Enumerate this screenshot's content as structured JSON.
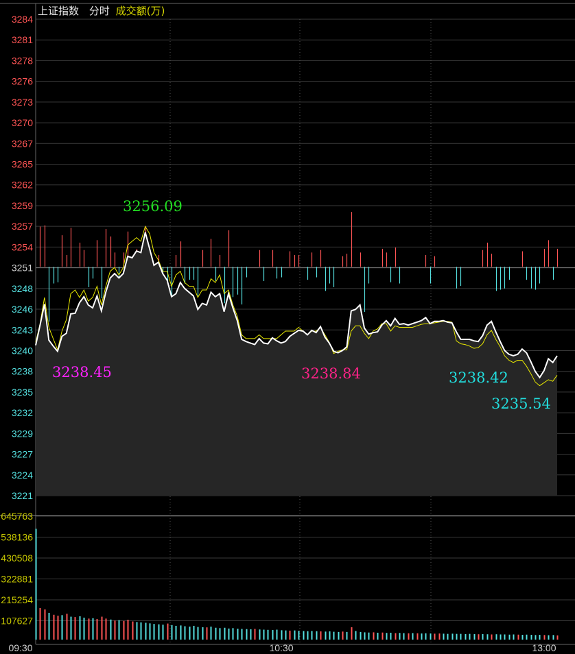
{
  "header": {
    "index_name": "上证指数",
    "mode": "分时",
    "indicator": "成交额(万)"
  },
  "colors": {
    "up": "#ff5555",
    "down": "#55e0e0",
    "price_line": "#ffffff",
    "avg_line": "#e8e800",
    "grid": "#3a3a3a",
    "annotation_high": "#22dd22",
    "annotation_low_1": "#ff22ff",
    "annotation_low_2": "#ff2288",
    "annotation_low_3": "#22dddd",
    "volume_axis": "#c8c800"
  },
  "chart_data": [
    {
      "type": "line",
      "name": "intraday-price",
      "y_axis_ticks": [
        "3284",
        "3281",
        "3278",
        "3276",
        "3273",
        "3270",
        "3267",
        "3265",
        "3262",
        "3259",
        "3257",
        "3254",
        "3251",
        "3248",
        "3246",
        "3243",
        "3240",
        "3238",
        "3235",
        "3232",
        "3229",
        "3227",
        "3224",
        "3221"
      ],
      "ylim": [
        3220.5,
        3284.2
      ],
      "baseline": 3251.1,
      "x_ticks": [
        "09:30",
        "10:30",
        "13:00"
      ],
      "x_count": 120,
      "series": [
        {
          "role": "price",
          "values": [
            3240.6,
            3243.3,
            3246.1,
            3241.3,
            3240.5,
            3239.8,
            3241.8,
            3242.2,
            3244.8,
            3244.9,
            3246.3,
            3247.1,
            3246.0,
            3245.6,
            3247.2,
            3245.2,
            3247.7,
            3249.6,
            3250.2,
            3249.6,
            3250.2,
            3252.5,
            3252.3,
            3253.2,
            3253.0,
            3255.7,
            3253.5,
            3251.3,
            3251.7,
            3250.2,
            3249.3,
            3247.1,
            3247.5,
            3249.0,
            3248.2,
            3247.7,
            3247.2,
            3245.4,
            3246.2,
            3246.0,
            3247.7,
            3247.1,
            3247.5,
            3245.1,
            3247.5,
            3245.6,
            3243.9,
            3241.4,
            3241.1,
            3240.9,
            3240.7,
            3241.5,
            3240.9,
            3240.8,
            3241.6,
            3241.2,
            3240.9,
            3241.1,
            3241.8,
            3242.2,
            3242.6,
            3242.5,
            3242.0,
            3242.6,
            3242.3,
            3243.1,
            3241.7,
            3240.9,
            3239.8,
            3239.6,
            3239.9,
            3240.4,
            3245.2,
            3245.4,
            3246.0,
            3242.9,
            3242.1,
            3242.3,
            3242.4,
            3243.3,
            3243.9,
            3243.2,
            3244.2,
            3243.4,
            3243.5,
            3243.3,
            3243.5,
            3243.7,
            3243.9,
            3244.3,
            3243.5,
            3243.8,
            3243.8,
            3243.9,
            3243.7,
            3243.6,
            3242.4,
            3241.4,
            3241.4,
            3241.4,
            3241.2,
            3241.1,
            3241.9,
            3243.3,
            3243.8,
            3242.4,
            3241.1,
            3239.9,
            3239.4,
            3239.2,
            3239.4,
            3240.1,
            3239.6,
            3238.4,
            3237.1,
            3236.3,
            3237.2,
            3238.8,
            3238.3,
            3239.2
          ]
        },
        {
          "role": "average",
          "values": [
            3241.0,
            3243.5,
            3247.0,
            3243.0,
            3241.5,
            3240.0,
            3242.5,
            3244.0,
            3247.5,
            3248.0,
            3247.0,
            3248.0,
            3246.5,
            3247.0,
            3248.5,
            3246.0,
            3248.5,
            3250.5,
            3251.0,
            3250.0,
            3251.0,
            3254.0,
            3254.5,
            3255.0,
            3254.5,
            3256.5,
            3255.5,
            3253.0,
            3252.0,
            3250.5,
            3250.5,
            3248.5,
            3250.0,
            3250.5,
            3249.0,
            3248.5,
            3248.5,
            3247.0,
            3248.0,
            3248.0,
            3249.5,
            3249.0,
            3250.0,
            3247.5,
            3248.0,
            3246.0,
            3244.5,
            3242.0,
            3241.5,
            3241.5,
            3241.5,
            3242.0,
            3241.5,
            3241.5,
            3241.5,
            3241.5,
            3242.0,
            3242.5,
            3242.5,
            3242.5,
            3243.0,
            3242.5,
            3242.0,
            3242.5,
            3242.5,
            3243.0,
            3242.0,
            3241.0,
            3239.5,
            3239.8,
            3240.0,
            3240.0,
            3242.5,
            3243.2,
            3243.2,
            3242.2,
            3241.5,
            3242.5,
            3242.8,
            3243.5,
            3243.5,
            3242.5,
            3243.2,
            3243.0,
            3243.0,
            3243.0,
            3243.0,
            3243.2,
            3243.4,
            3243.5,
            3243.5,
            3243.6,
            3243.7,
            3243.8,
            3243.8,
            3243.7,
            3241.2,
            3240.8,
            3240.7,
            3240.5,
            3240.2,
            3240.3,
            3240.8,
            3242.0,
            3242.6,
            3241.4,
            3240.4,
            3239.2,
            3238.6,
            3238.3,
            3238.6,
            3238.6,
            3237.8,
            3236.8,
            3235.7,
            3235.2,
            3235.6,
            3236.0,
            3235.8,
            3236.6
          ]
        }
      ],
      "annotations": [
        {
          "text": "3256.09",
          "role": "high"
        },
        {
          "text": "3238.45",
          "role": "low_1"
        },
        {
          "text": "3238.84",
          "role": "low_2"
        },
        {
          "text": "3238.42",
          "role": "low_3"
        },
        {
          "text": "3235.54",
          "role": "low_4"
        }
      ],
      "grid": true
    },
    {
      "type": "bar",
      "name": "turnover",
      "y_axis_ticks": [
        "645763",
        "538136",
        "430508",
        "322881",
        "215254",
        "107627"
      ],
      "ylim": [
        0,
        645763
      ],
      "x_count": 120,
      "values": [
        580000,
        165000,
        158000,
        140000,
        130000,
        125000,
        128000,
        135000,
        120000,
        118000,
        122000,
        115000,
        110000,
        112000,
        108000,
        120000,
        110000,
        105000,
        100000,
        102000,
        98000,
        104000,
        95000,
        92000,
        90000,
        88000,
        85000,
        82000,
        80000,
        78000,
        84000,
        76000,
        72000,
        74000,
        70000,
        68000,
        72000,
        66000,
        65000,
        64000,
        68000,
        62000,
        60000,
        62000,
        58000,
        60000,
        57000,
        56000,
        55000,
        54000,
        56000,
        53000,
        52000,
        51000,
        50000,
        52000,
        49000,
        48000,
        47000,
        48000,
        46000,
        45000,
        44000,
        45000,
        44000,
        43000,
        42000,
        43000,
        41000,
        40000,
        42000,
        40000,
        65000,
        45000,
        40000,
        38000,
        37000,
        38000,
        36000,
        37000,
        35000,
        36000,
        34000,
        35000,
        34000,
        33000,
        34000,
        33000,
        32000,
        33000,
        32000,
        31000,
        32000,
        31000,
        30000,
        31000,
        30000,
        30000,
        29000,
        30000,
        29000,
        28000,
        29000,
        28000,
        27000,
        28000,
        27000,
        27000,
        26000,
        27000,
        26000,
        25000,
        26000,
        25000,
        24000,
        25000,
        24000,
        23000,
        24000,
        22000
      ],
      "colors_pattern": [
        "down",
        "up",
        "up",
        "down",
        "up",
        "up",
        "down",
        "up",
        "down",
        "up",
        "down",
        "down",
        "up",
        "down",
        "up",
        "up",
        "up",
        "down",
        "up",
        "down",
        "up",
        "up",
        "up",
        "down",
        "down",
        "down",
        "down",
        "down",
        "down",
        "down",
        "up",
        "down",
        "down",
        "down",
        "down",
        "down",
        "down",
        "down",
        "down",
        "up",
        "down",
        "down",
        "down",
        "down",
        "down",
        "down",
        "down",
        "down",
        "down",
        "down",
        "up",
        "down",
        "down",
        "down",
        "down",
        "down",
        "down",
        "down",
        "up",
        "down",
        "down",
        "down",
        "down",
        "down",
        "down",
        "up",
        "down",
        "down",
        "down",
        "down",
        "up",
        "down",
        "up",
        "down",
        "down",
        "down",
        "down",
        "up",
        "down",
        "up",
        "down",
        "down",
        "up",
        "down",
        "down",
        "up",
        "down",
        "up",
        "down",
        "down",
        "down",
        "up",
        "up",
        "down",
        "down",
        "down",
        "down",
        "down",
        "down",
        "down",
        "down",
        "up",
        "down",
        "down",
        "up",
        "down",
        "down",
        "down",
        "down",
        "down",
        "up",
        "down",
        "down",
        "down",
        "down",
        "down",
        "up",
        "down",
        "down",
        "up"
      ],
      "grid": true
    }
  ]
}
